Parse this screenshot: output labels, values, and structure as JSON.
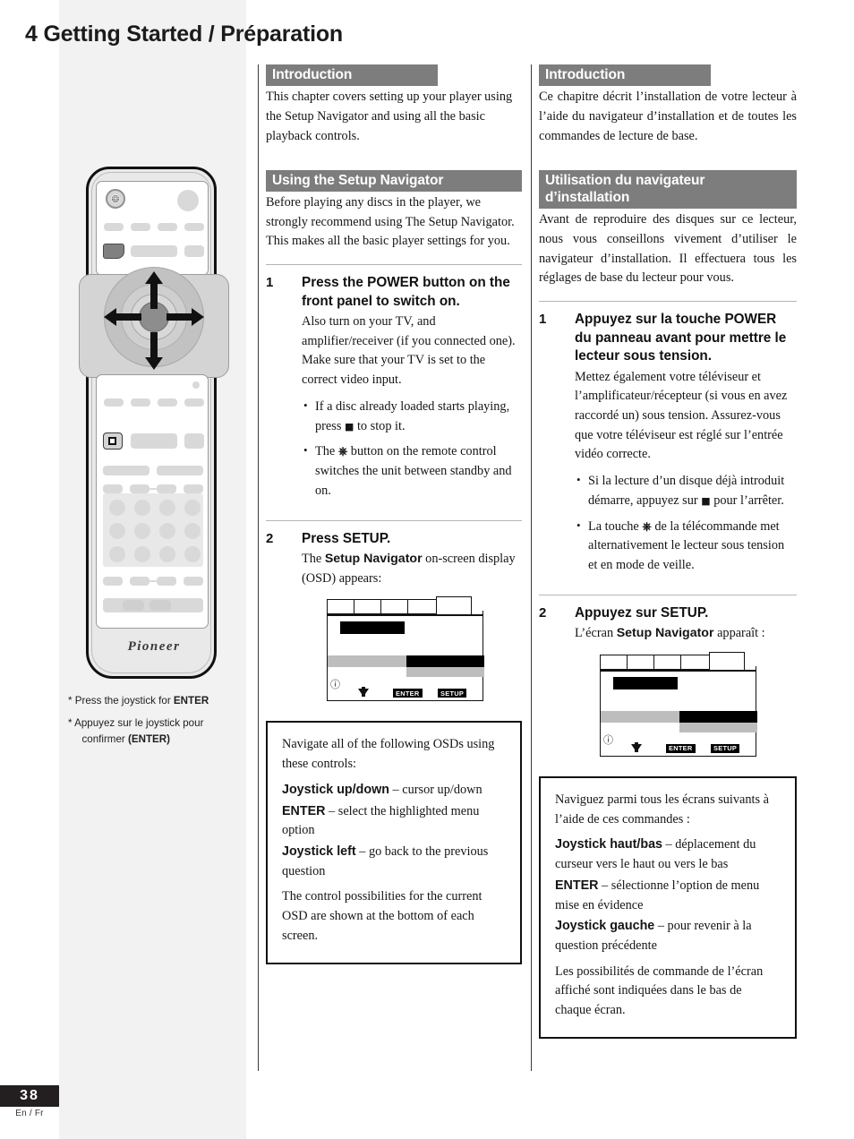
{
  "page": {
    "title": "4 Getting Started / Préparation",
    "number": "38",
    "language_note": "En / Fr"
  },
  "remote": {
    "logo": "Pioneer",
    "caption_en": "* Press the joystick for ENTER",
    "caption_en_plain": "* Press the joystick for ",
    "caption_en_bold": "ENTER",
    "caption_fr_line1": "* Appuyez sur le joystick pour",
    "caption_fr_line2_plain": "confirmer ",
    "caption_fr_line2_bold": "(ENTER)"
  },
  "english": {
    "intro_heading": "Introduction",
    "intro_text": "This chapter covers setting up your player using the Setup Navigator and using all the basic playback controls.",
    "setup_heading": "Using the Setup Navigator",
    "setup_text": "Before playing any discs in the player, we strongly recommend using The Setup Navigator. This makes all the basic player settings for you.",
    "step1": {
      "number": "1",
      "title": "Press the POWER button on the front panel to switch on.",
      "text": "Also turn on your TV, and amplifier/receiver (if you connected one). Make sure that your TV is set to the correct video input.",
      "bullets": [
        {
          "before": "If a disc already loaded starts playing, press ",
          "icon": "stop-square-icon",
          "after": " to stop it."
        },
        {
          "before": "The ",
          "icon": "power-standby-icon",
          "after": " button on the remote control switches the unit between standby and on."
        }
      ]
    },
    "step2": {
      "number": "2",
      "title": "Press SETUP.",
      "text_before": "The ",
      "text_bold": "Setup Navigator",
      "text_after": " on-screen display (OSD) appears:"
    },
    "osd": {
      "info_icon": "information-icon",
      "enter_key": "ENTER",
      "setup_key": "SETUP"
    },
    "info_box": {
      "intro": "Navigate all of the following OSDs using these controls:",
      "items": [
        {
          "term": "Joystick up/down",
          "desc": " – cursor up/down"
        },
        {
          "term": "ENTER",
          "desc": " – select the highlighted menu option"
        },
        {
          "term": "Joystick left",
          "desc": " – go back to the previous question"
        }
      ],
      "closing": "The control possibilities for the current OSD are shown at the bottom of each screen."
    }
  },
  "french": {
    "intro_heading": "Introduction",
    "intro_text": "Ce chapitre décrit l’installation de votre lecteur à l’aide du navigateur d’installation et de toutes les commandes de lecture de base.",
    "setup_heading": "Utilisation du navigateur d’installation",
    "setup_text": "Avant de reproduire des disques sur ce lecteur, nous vous conseillons vivement d’utiliser le navigateur d’installation. Il effectuera tous les réglages de base du lecteur pour vous.",
    "step1": {
      "number": "1",
      "title": "Appuyez sur la touche POWER du panneau avant pour mettre le lecteur sous tension.",
      "text": "Mettez également votre téléviseur et l’amplificateur/récepteur (si vous en avez raccordé un) sous tension. Assurez-vous que votre téléviseur est réglé sur l’entrée vidéo correcte.",
      "bullets": [
        {
          "before": "Si la lecture d’un disque déjà introduit démarre, appuyez sur ",
          "icon": "stop-square-icon",
          "after": " pour l’arrêter."
        },
        {
          "before": "La touche ",
          "icon": "power-standby-icon",
          "after": " de la télécommande met alternativement le lecteur sous tension et en mode de veille."
        }
      ]
    },
    "step2": {
      "number": "2",
      "title": "Appuyez sur SETUP.",
      "text_before": "L’écran ",
      "text_bold": "Setup Navigator",
      "text_after": " apparaît :"
    },
    "osd": {
      "info_icon": "information-icon",
      "enter_key": "ENTER",
      "setup_key": "SETUP"
    },
    "info_box": {
      "intro": "Naviguez parmi tous les écrans suivants à l’aide de ces commandes :",
      "items": [
        {
          "term": "Joystick haut/bas",
          "desc": " – déplacement du curseur vers le haut ou vers le bas"
        },
        {
          "term": "ENTER",
          "desc": " – sélectionne l’option de menu mise en évidence"
        },
        {
          "term": "Joystick gauche",
          "desc": " – pour revenir à la question précédente"
        }
      ],
      "closing": "Les possibilités de commande de l’écran affiché sont indiquées dans le bas de chaque écran."
    }
  },
  "colors": {
    "heading_bar": "#7d7d7d",
    "sidebar": "#f2f2f2",
    "page_num_bg": "#231f20"
  }
}
